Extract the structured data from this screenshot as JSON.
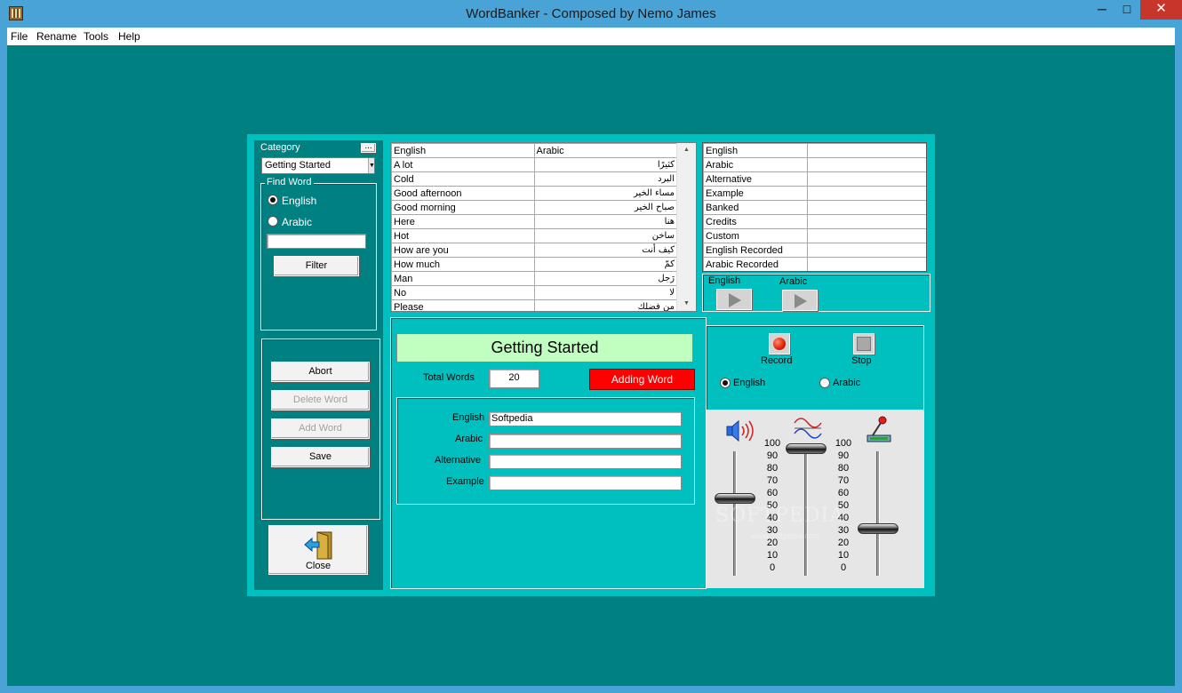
{
  "window": {
    "title": "WordBanker - Composed by Nemo James",
    "minimize": "─",
    "maximize": "□",
    "close": "✕"
  },
  "menu": [
    "File",
    "Rename",
    "Tools",
    "Help"
  ],
  "sidebar": {
    "category_label": "Category",
    "category_more": "...",
    "category_value": "Getting Started",
    "find_word_label": "Find Word",
    "radio_english": "English",
    "radio_arabic": "Arabic",
    "search_value": "",
    "filter_button": "Filter",
    "abort_button": "Abort",
    "delete_word_button": "Delete Word",
    "add_word_button": "Add Word",
    "save_button": "Save",
    "close_button": "Close"
  },
  "word_table": {
    "headers": [
      "English",
      "Arabic"
    ],
    "rows": [
      [
        "A lot",
        "كثيرًا"
      ],
      [
        "Cold",
        "البرد"
      ],
      [
        "Good afternoon",
        "مساء الخير"
      ],
      [
        "Good morning",
        "صباح الخير"
      ],
      [
        "Here",
        "هنا"
      ],
      [
        "Hot",
        "ساخن"
      ],
      [
        "How are you",
        "كيف أنت"
      ],
      [
        "How much",
        "كمّ"
      ],
      [
        "Man",
        "رَجل"
      ],
      [
        "No",
        "لا"
      ],
      [
        "Please",
        "من فضلك"
      ]
    ]
  },
  "details_table": {
    "rows": [
      [
        "English",
        ""
      ],
      [
        "Arabic",
        ""
      ],
      [
        "Alternative",
        ""
      ],
      [
        "Example",
        ""
      ],
      [
        "Banked",
        ""
      ],
      [
        "Credits",
        ""
      ],
      [
        "Custom",
        ""
      ],
      [
        "English Recorded",
        ""
      ],
      [
        "Arabic Recorded",
        ""
      ]
    ]
  },
  "playback": {
    "english_label": "English",
    "arabic_label": "Arabic"
  },
  "main": {
    "banner": "Getting Started",
    "total_words_label": "Total Words",
    "total_words_value": "20",
    "status": "Adding Word",
    "fields": {
      "english_label": "English",
      "english_value": "Softpedia",
      "arabic_label": "Arabic",
      "arabic_value": "",
      "alternative_label": "Alternative",
      "alternative_value": "",
      "example_label": "Example",
      "example_value": ""
    }
  },
  "recorder": {
    "record_label": "Record",
    "stop_label": "Stop",
    "radio_english": "English",
    "radio_arabic": "Arabic",
    "scale": [
      "100",
      "90",
      "80",
      "70",
      "60",
      "50",
      "40",
      "30",
      "20",
      "10",
      "0"
    ],
    "volume_level": 50,
    "balance_level": 100,
    "mic_level": 20
  },
  "watermark": {
    "logo": "SOFTPEDIA",
    "url": "www.softpedia.com"
  },
  "colors": {
    "teal_dark": "#008080",
    "teal_light": "#00bfbf",
    "banner_green": "#c0ffc0",
    "status_red": "#ff0000"
  }
}
